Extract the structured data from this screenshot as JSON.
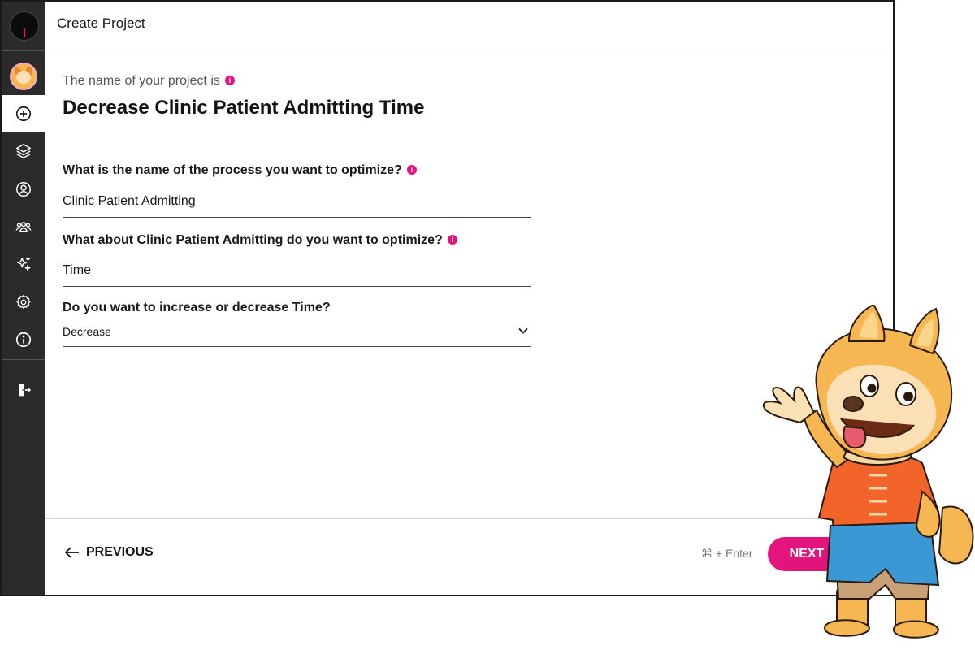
{
  "header": {
    "title": "Create Project"
  },
  "sidebar": {
    "items": [
      {
        "name": "create",
        "icon": "plus-circle-icon",
        "active": true
      },
      {
        "name": "projects",
        "icon": "layers-icon"
      },
      {
        "name": "profile",
        "icon": "user-circle-icon"
      },
      {
        "name": "team",
        "icon": "users-icon"
      },
      {
        "name": "ai",
        "icon": "sparkles-icon"
      },
      {
        "name": "settings",
        "icon": "gear-icon"
      },
      {
        "name": "about",
        "icon": "info-icon"
      },
      {
        "name": "logout",
        "icon": "logout-icon"
      }
    ]
  },
  "form": {
    "project_label": "The name of your project is",
    "project_name": "Decrease Clinic Patient Admitting Time",
    "q1_label": "What is the name of the process you want to optimize?",
    "q1_value": "Clinic Patient Admitting",
    "q2_label": "What about Clinic Patient Admitting do you want to optimize?",
    "q2_value": "Time",
    "q3_label": "Do you want to increase or decrease Time?",
    "q3_value": "Decrease"
  },
  "footer": {
    "previous_label": "PREVIOUS",
    "shortcut": "⌘ + Enter",
    "next_label": "NEXT"
  },
  "colors": {
    "accent": "#e3147e",
    "sidebar": "#2b2b2b",
    "mascot_fur": "#f6b652",
    "mascot_shirt": "#f3642a",
    "mascot_apron": "#3a98d4"
  }
}
